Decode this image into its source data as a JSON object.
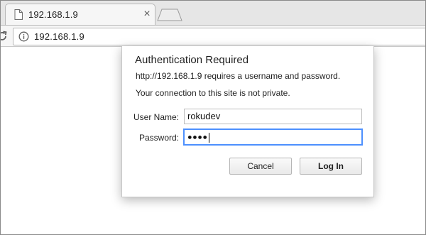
{
  "browser": {
    "tab": {
      "title": "192.168.1.9",
      "close_glyph": "×"
    },
    "address_bar": {
      "url": "192.168.1.9"
    },
    "icons": {
      "tab_favicon": "page-icon",
      "new_tab": "new-tab-icon",
      "reload": "reload-icon",
      "site_info": "info-icon"
    }
  },
  "auth_dialog": {
    "title": "Authentication Required",
    "message": "http://192.168.1.9 requires a username and password.",
    "warning": "Your connection to this site is not private.",
    "username_label": "User Name:",
    "username_value": "rokudev",
    "password_label": "Password:",
    "password_mask": "●●●●",
    "cancel_label": "Cancel",
    "login_label": "Log In"
  },
  "colors": {
    "focus_ring": "#4d90fe",
    "tab_strip": "#e6e6e6",
    "toolbar": "#f6f6f6"
  }
}
